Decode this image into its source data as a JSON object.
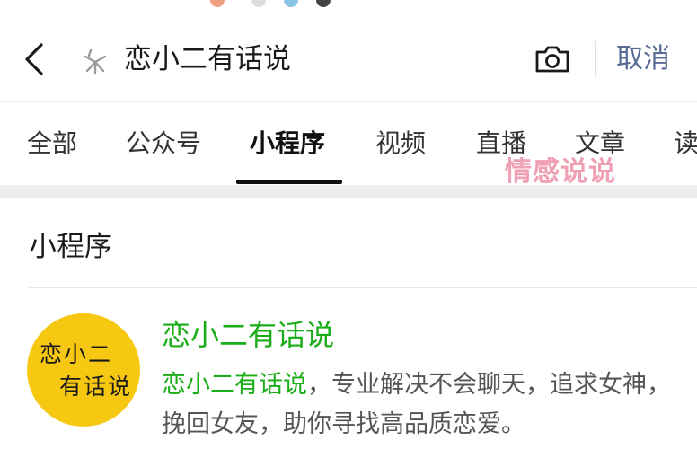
{
  "header": {
    "search_query": "恋小二有话说",
    "cancel_label": "取消"
  },
  "tabs": [
    {
      "label": "全部",
      "active": false
    },
    {
      "label": "公众号",
      "active": false
    },
    {
      "label": "小程序",
      "active": true
    },
    {
      "label": "视频",
      "active": false
    },
    {
      "label": "直播",
      "active": false
    },
    {
      "label": "文章",
      "active": false
    },
    {
      "label": "读",
      "active": false
    }
  ],
  "watermark": "情感说说",
  "section": {
    "title": "小程序"
  },
  "result": {
    "avatar_line1": "恋小二",
    "avatar_line2": "有话说",
    "name": "恋小二有话说",
    "desc_highlight": "恋小二有话说",
    "desc_rest": "，专业解决不会聊天，追求女神，挽回女友，助你寻找高品质恋爱。"
  },
  "colors": {
    "accent_green": "#1aad19",
    "link_blue": "#576b95",
    "avatar_yellow": "#f7c812",
    "watermark_pink": "#f0a0b4"
  },
  "icons": {
    "back": "chevron-left-icon",
    "search_prefix": "sparkle-search-icon",
    "camera": "camera-icon"
  }
}
